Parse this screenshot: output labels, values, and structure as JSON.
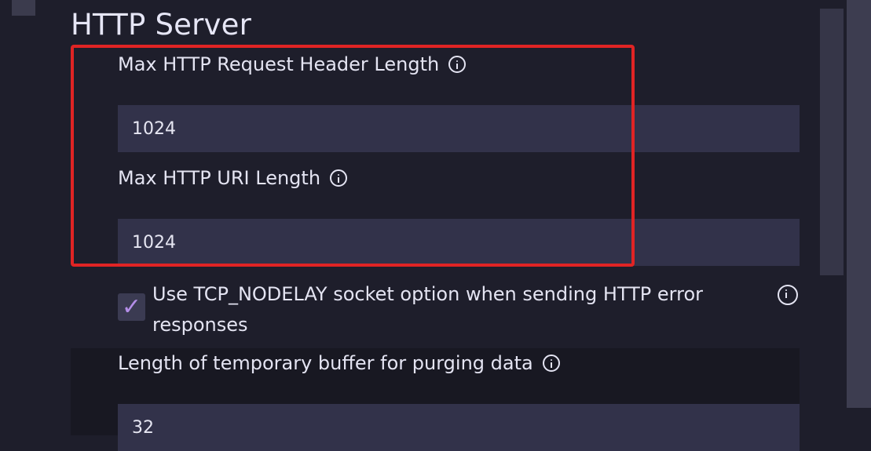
{
  "section": {
    "title": "HTTP Server"
  },
  "fields": {
    "max_header": {
      "label": "Max HTTP Request Header Length",
      "value": "1024"
    },
    "max_uri": {
      "label": "Max HTTP URI Length",
      "value": "1024"
    },
    "tcp_nodelay": {
      "label": "Use TCP_NODELAY socket option when sending HTTP error responses",
      "checked": true,
      "check_glyph": "✓"
    },
    "purge_buffer": {
      "label": "Length of temporary buffer for purging data",
      "value": "32"
    }
  },
  "colors": {
    "background": "#1e1e2b",
    "input": "#32324a",
    "highlight": "#e02424",
    "check": "#b48ee8"
  },
  "icons": [
    "info-icon",
    "check-icon"
  ]
}
